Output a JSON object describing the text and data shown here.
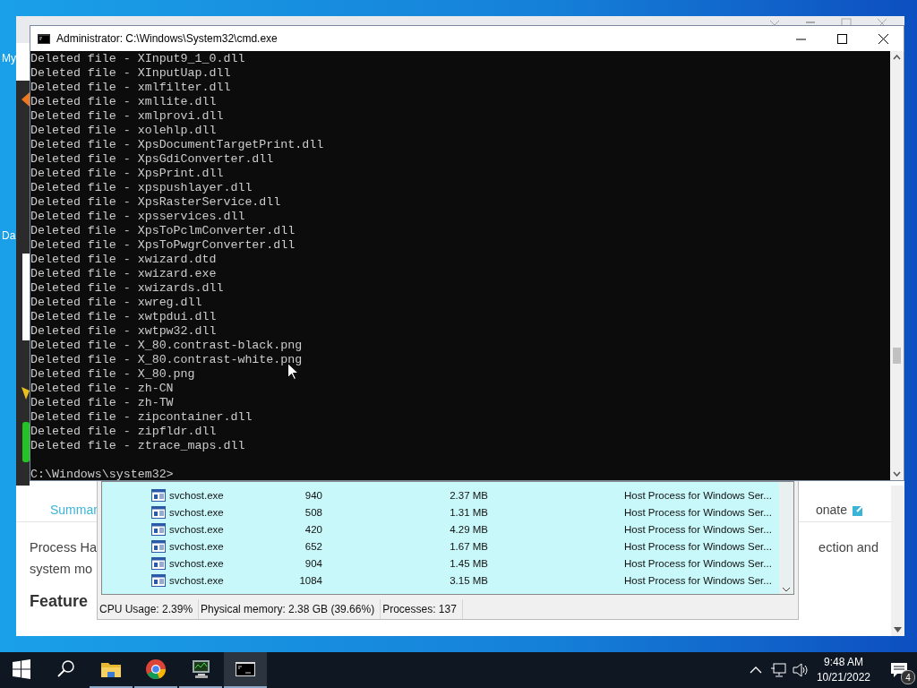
{
  "desktop": {
    "icon_labels": [
      "My",
      "Da"
    ]
  },
  "browser_window": {
    "nav_link": "Summar",
    "donate_link": "onate",
    "paragraph_left": [
      "Process Ha",
      "system mo"
    ],
    "paragraph_right": "ection and",
    "heading": "Feature"
  },
  "process_window": {
    "rows": [
      {
        "name": "svchost.exe",
        "pid": "940",
        "memory": "2.37 MB",
        "description": "Host Process for Windows Ser..."
      },
      {
        "name": "svchost.exe",
        "pid": "508",
        "memory": "1.31 MB",
        "description": "Host Process for Windows Ser..."
      },
      {
        "name": "svchost.exe",
        "pid": "420",
        "memory": "4.29 MB",
        "description": "Host Process for Windows Ser..."
      },
      {
        "name": "svchost.exe",
        "pid": "652",
        "memory": "1.67 MB",
        "description": "Host Process for Windows Ser..."
      },
      {
        "name": "svchost.exe",
        "pid": "904",
        "memory": "1.45 MB",
        "description": "Host Process for Windows Ser..."
      },
      {
        "name": "svchost.exe",
        "pid": "1084",
        "memory": "3.15 MB",
        "description": "Host Process for Windows Ser..."
      }
    ],
    "status_bar": [
      "CPU Usage: 2.39%",
      "Physical memory: 2.38 GB (39.66%)",
      "Processes: 137"
    ]
  },
  "cmd_window": {
    "title": "Administrator:  C:\\Windows\\System32\\cmd.exe",
    "lines": [
      "Deleted file - XInput9_1_0.dll",
      "Deleted file - XInputUap.dll",
      "Deleted file - xmlfilter.dll",
      "Deleted file - xmllite.dll",
      "Deleted file - xmlprovi.dll",
      "Deleted file - xolehlp.dll",
      "Deleted file - XpsDocumentTargetPrint.dll",
      "Deleted file - XpsGdiConverter.dll",
      "Deleted file - XpsPrint.dll",
      "Deleted file - xpspushlayer.dll",
      "Deleted file - XpsRasterService.dll",
      "Deleted file - xpsservices.dll",
      "Deleted file - XpsToPclmConverter.dll",
      "Deleted file - XpsToPwgrConverter.dll",
      "Deleted file - xwizard.dtd",
      "Deleted file - xwizard.exe",
      "Deleted file - xwizards.dll",
      "Deleted file - xwreg.dll",
      "Deleted file - xwtpdui.dll",
      "Deleted file - xwtpw32.dll",
      "Deleted file - X_80.contrast-black.png",
      "Deleted file - X_80.contrast-white.png",
      "Deleted file - X_80.png",
      "Deleted file - zh-CN",
      "Deleted file - zh-TW",
      "Deleted file - zipcontainer.dll",
      "Deleted file - zipfldr.dll",
      "Deleted file - ztrace_maps.dll"
    ],
    "prompt": "C:\\Windows\\system32>"
  },
  "taskbar": {
    "buttons": [
      {
        "kind": "start",
        "running": false,
        "selected": false
      },
      {
        "kind": "search",
        "running": false,
        "selected": false
      },
      {
        "kind": "folder",
        "running": true,
        "selected": false
      },
      {
        "kind": "browser",
        "running": true,
        "selected": false
      },
      {
        "kind": "monitor",
        "running": true,
        "selected": false
      },
      {
        "kind": "terminal",
        "running": true,
        "selected": true
      }
    ],
    "time": "9:48 AM",
    "date": "10/21/2022",
    "notification_count": "4"
  }
}
